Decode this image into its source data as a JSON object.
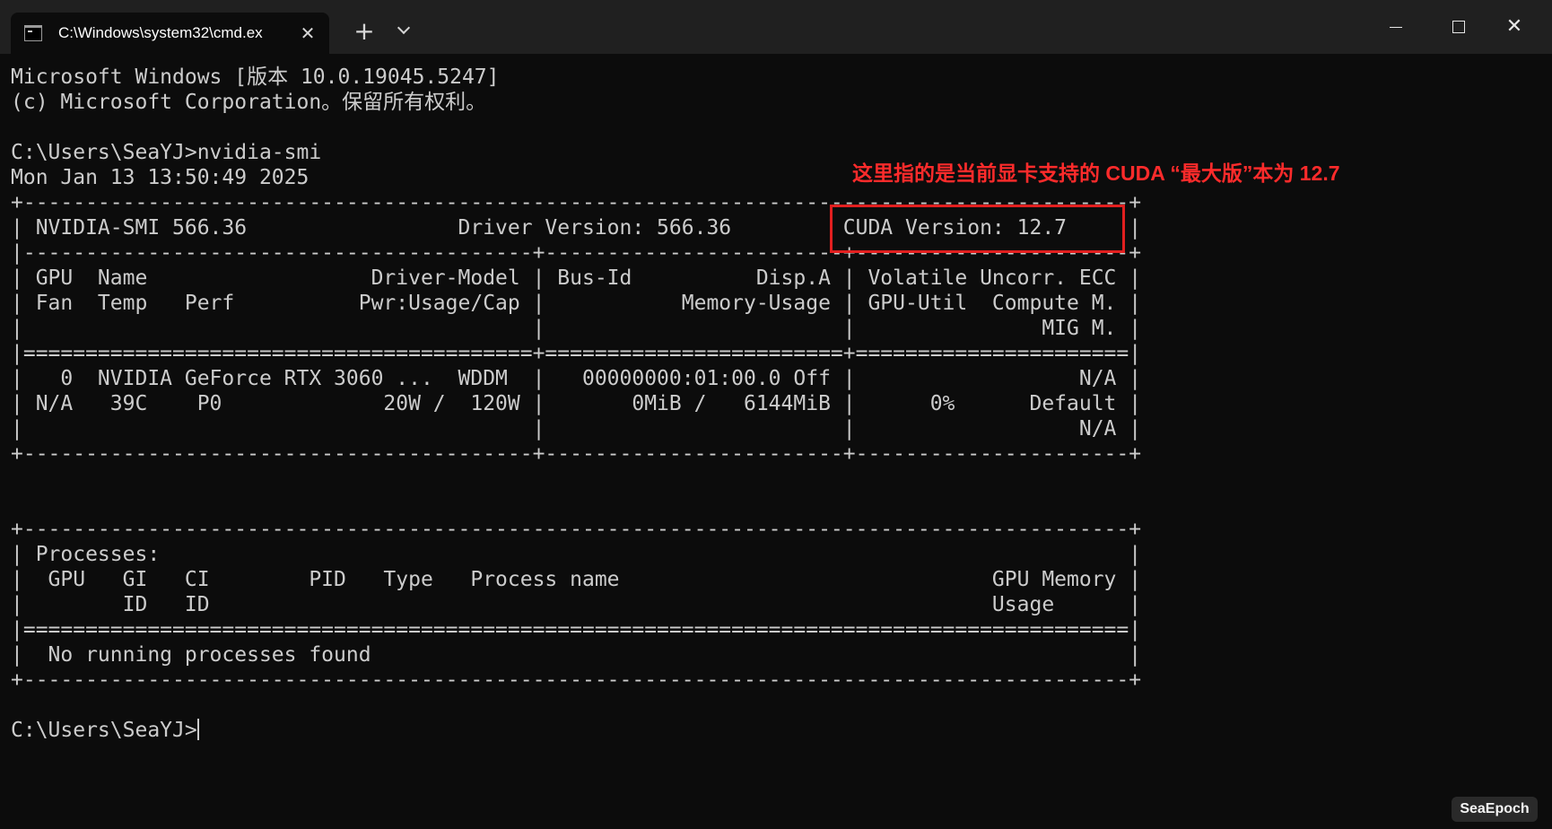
{
  "window": {
    "tab_title": "C:\\Windows\\system32\\cmd.ex",
    "tab_close": "✕",
    "new_tab": "+",
    "close": "✕"
  },
  "terminal": {
    "text": "Microsoft Windows [版本 10.0.19045.5247]\n(c) Microsoft Corporation。保留所有权利。\n\nC:\\Users\\SeaYJ>nvidia-smi\nMon Jan 13 13:50:49 2025\n+-----------------------------------------------------------------------------------------+\n| NVIDIA-SMI 566.36                 Driver Version: 566.36         CUDA Version: 12.7     |\n|-----------------------------------------+------------------------+----------------------+\n| GPU  Name                  Driver-Model | Bus-Id          Disp.A | Volatile Uncorr. ECC |\n| Fan  Temp   Perf          Pwr:Usage/Cap |           Memory-Usage | GPU-Util  Compute M. |\n|                                         |                        |               MIG M. |\n|=========================================+========================+======================|\n|   0  NVIDIA GeForce RTX 3060 ...  WDDM  |   00000000:01:00.0 Off |                  N/A |\n| N/A   39C    P0             20W /  120W |       0MiB /   6144MiB |      0%      Default |\n|                                         |                        |                  N/A |\n+-----------------------------------------+------------------------+----------------------+\n\n\n+-----------------------------------------------------------------------------------------+\n| Processes:                                                                              |\n|  GPU   GI   CI        PID   Type   Process name                              GPU Memory |\n|        ID   ID                                                               Usage      |\n|=========================================================================================|\n|  No running processes found                                                             |\n+-----------------------------------------------------------------------------------------+\n\nC:\\Users\\SeaYJ>"
  },
  "annotation": {
    "text": "这里指的是当前显卡支持的 CUDA “最大版”本为 12.7",
    "color": "#ff2b2b"
  },
  "watermark": "SeaEpoch",
  "colors": {
    "background": "#0c0c0c",
    "titlebar": "#202020",
    "text": "#cccccc",
    "highlight": "#e21f1f"
  }
}
